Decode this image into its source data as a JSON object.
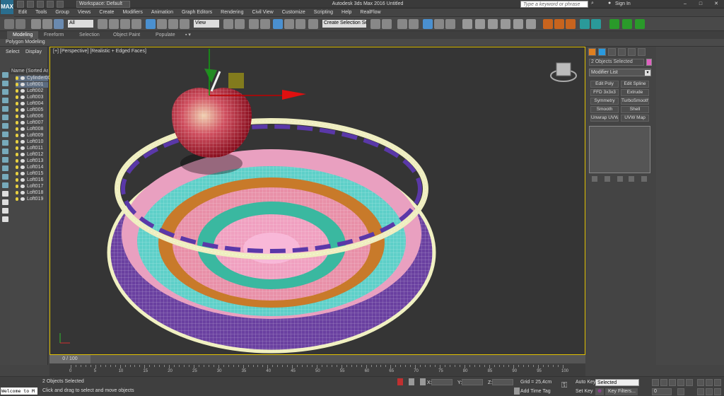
{
  "titlebar": {
    "app_logo": "MAX",
    "workspace": "Workspace: Default",
    "window_title": "Autodesk 3ds Max 2016   Untitled",
    "search_placeholder": "Type a keyword or phrase",
    "signin": "Sign In"
  },
  "menu": [
    "Edit",
    "Tools",
    "Group",
    "Views",
    "Create",
    "Modifiers",
    "Animation",
    "Graph Editors",
    "Rendering",
    "Civil View",
    "Customize",
    "Scripting",
    "Help",
    "RealFlow"
  ],
  "toolbar": {
    "filter_select": "All",
    "refcoord_select": "View",
    "selection_set": "Create Selection Se"
  },
  "ribbon": {
    "tabs": [
      "Modeling",
      "Freeform",
      "Selection",
      "Object Paint",
      "Populate"
    ],
    "panel_label": "Polygon Modeling"
  },
  "scene_explorer": {
    "tabs": [
      "Select",
      "Display"
    ],
    "header": "Name (Sorted Ascending)",
    "items": [
      "Cylinder001",
      "Loft001",
      "Loft002",
      "Loft003",
      "Loft004",
      "Loft005",
      "Loft006",
      "Loft007",
      "Loft008",
      "Loft009",
      "Loft010",
      "Loft011",
      "Loft012",
      "Loft013",
      "Loft014",
      "Loft015",
      "Loft016",
      "Loft017",
      "Loft018",
      "Loft019"
    ]
  },
  "viewport": {
    "label": "[+] [Perspective] [Realistic + Edged Faces]"
  },
  "command_panel": {
    "selected": "2 Objects Selected",
    "modifier_list": "Modifier List",
    "buttons": [
      "Edit Poly",
      "Edit Spline",
      "FFD 3x3x3",
      "Extrude",
      "Symmetry",
      "TurboSmooth",
      "Smooth",
      "Shell",
      "Unwrap UVW",
      "UVW Map"
    ]
  },
  "timeline": {
    "slider": "0 / 100",
    "ticks": [
      "0",
      "5",
      "10",
      "15",
      "20",
      "25",
      "30",
      "35",
      "40",
      "45",
      "50",
      "55",
      "60",
      "65",
      "70",
      "75",
      "80",
      "85",
      "90",
      "95",
      "100"
    ]
  },
  "status": {
    "maxscript": "Welcome to M",
    "objects_selected": "2 Objects Selected",
    "prompt": "Click and drag to select and move objects",
    "x_label": "X:",
    "y_label": "Y:",
    "z_label": "Z:",
    "grid": "Grid = 25,4cm",
    "add_time_tag": "Add Time Tag",
    "auto_key": "Auto Key",
    "set_key": "Set Key",
    "selected_dropdown": "Selected",
    "key_filters": "Key Filters...",
    "frame": "0"
  },
  "colors": {
    "accent_yellow": "#e0c000",
    "swatch": "#e060c0"
  }
}
